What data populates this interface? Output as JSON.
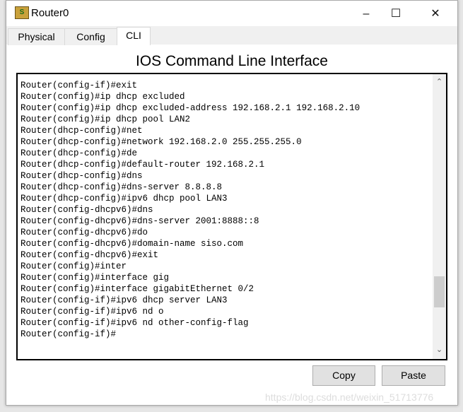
{
  "window": {
    "title": "Router0",
    "icon": "router-icon"
  },
  "tabs": [
    {
      "label": "Physical"
    },
    {
      "label": "Config"
    },
    {
      "label": "CLI",
      "active": true
    }
  ],
  "heading": "IOS Command Line Interface",
  "terminal": {
    "lines": [
      "",
      "Router(config-if)#exit",
      "Router(config)#ip dhcp excluded",
      "Router(config)#ip dhcp excluded-address 192.168.2.1 192.168.2.10",
      "Router(config)#ip dhcp pool LAN2",
      "Router(dhcp-config)#net",
      "Router(dhcp-config)#network 192.168.2.0 255.255.255.0",
      "Router(dhcp-config)#de",
      "Router(dhcp-config)#default-router 192.168.2.1",
      "Router(dhcp-config)#dns",
      "Router(dhcp-config)#dns-server 8.8.8.8",
      "Router(dhcp-config)#ipv6 dhcp pool LAN3",
      "Router(config-dhcpv6)#dns",
      "Router(config-dhcpv6)#dns-server 2001:8888::8",
      "Router(config-dhcpv6)#do",
      "Router(config-dhcpv6)#domain-name siso.com",
      "Router(config-dhcpv6)#exit",
      "Router(config)#inter",
      "Router(config)#interface gig",
      "Router(config)#interface gigabitEthernet 0/2",
      "Router(config-if)#ipv6 dhcp server LAN3",
      "Router(config-if)#ipv6 nd o",
      "Router(config-if)#ipv6 nd other-config-flag",
      "Router(config-if)#"
    ]
  },
  "buttons": {
    "copy": "Copy",
    "paste": "Paste"
  },
  "watermark": "https://blog.csdn.net/weixin_51713776"
}
